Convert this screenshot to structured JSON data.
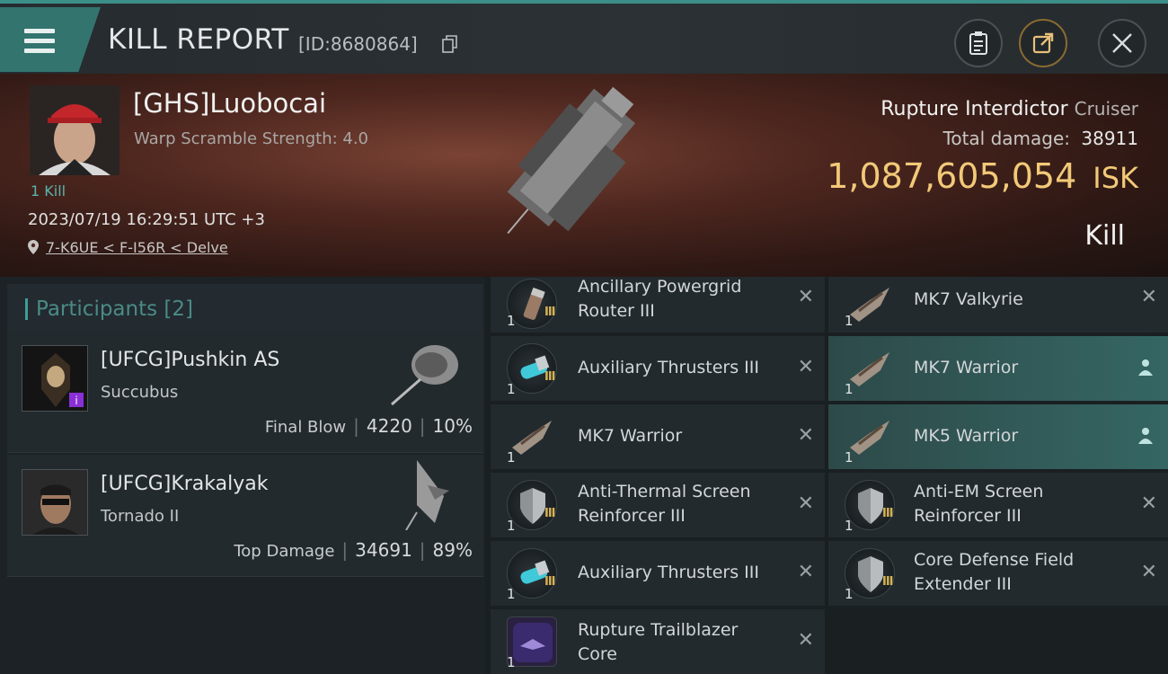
{
  "header": {
    "title": "KILL REPORT",
    "kill_id": "[ID:8680864]",
    "icons": [
      "menu-icon",
      "copy-icon",
      "clipboard-icon",
      "share-icon",
      "close-icon"
    ]
  },
  "victim": {
    "pilot": "[GHS]Luobocai",
    "scramble": "Warp Scramble Strength: 4.0",
    "kill_tag": "1 Kill",
    "datetime": "2023/07/19 16:29:51 UTC +3",
    "location": "7-K6UE < F-I56R < Delve",
    "ship_name": "Rupture Interdictor",
    "ship_class": "Cruiser",
    "total_damage_label": "Total damage:",
    "total_damage": "38911",
    "isk_value": "1,087,605,054",
    "isk_unit": "ISK",
    "result": "Kill"
  },
  "participants": {
    "title": "Participants",
    "count": "[2]",
    "list": [
      {
        "name": "[UFCG]Pushkin AS",
        "ship": "Succubus",
        "label": "Final Blow",
        "damage": "4220",
        "percent": "10%"
      },
      {
        "name": "[UFCG]Krakalyak",
        "ship": "Tornado II",
        "label": "Top Damage",
        "damage": "34691",
        "percent": "89%"
      }
    ]
  },
  "items": {
    "left": [
      {
        "name1": "Ancillary Powergrid",
        "name2": "Router III",
        "qty": "1",
        "tier": "III"
      },
      {
        "name1": "Auxiliary Thrusters III",
        "name2": "",
        "qty": "1",
        "tier": "III"
      },
      {
        "name1": "MK7  Warrior",
        "name2": "",
        "qty": "1",
        "tier": ""
      },
      {
        "name1": "Anti-Thermal Screen",
        "name2": "Reinforcer III",
        "qty": "1",
        "tier": "III"
      },
      {
        "name1": "Auxiliary Thrusters III",
        "name2": "",
        "qty": "1",
        "tier": "III"
      },
      {
        "name1": "Rupture Trailblazer",
        "name2": "Core",
        "qty": "1",
        "tier": ""
      }
    ],
    "right": [
      {
        "name1": "MK7  Valkyrie",
        "name2": "",
        "qty": "1",
        "tier": ""
      },
      {
        "name1": "MK7  Warrior",
        "name2": "",
        "qty": "1",
        "tier": ""
      },
      {
        "name1": "MK5  Warrior",
        "name2": "",
        "qty": "1",
        "tier": ""
      },
      {
        "name1": "Anti-EM Screen",
        "name2": "Reinforcer III",
        "qty": "1",
        "tier": "III"
      },
      {
        "name1": "Core Defense Field",
        "name2": "Extender III",
        "qty": "1",
        "tier": "III"
      }
    ]
  },
  "colors": {
    "accent": "#3c8e88",
    "isk": "#f2c978",
    "highlight": "#356663"
  }
}
